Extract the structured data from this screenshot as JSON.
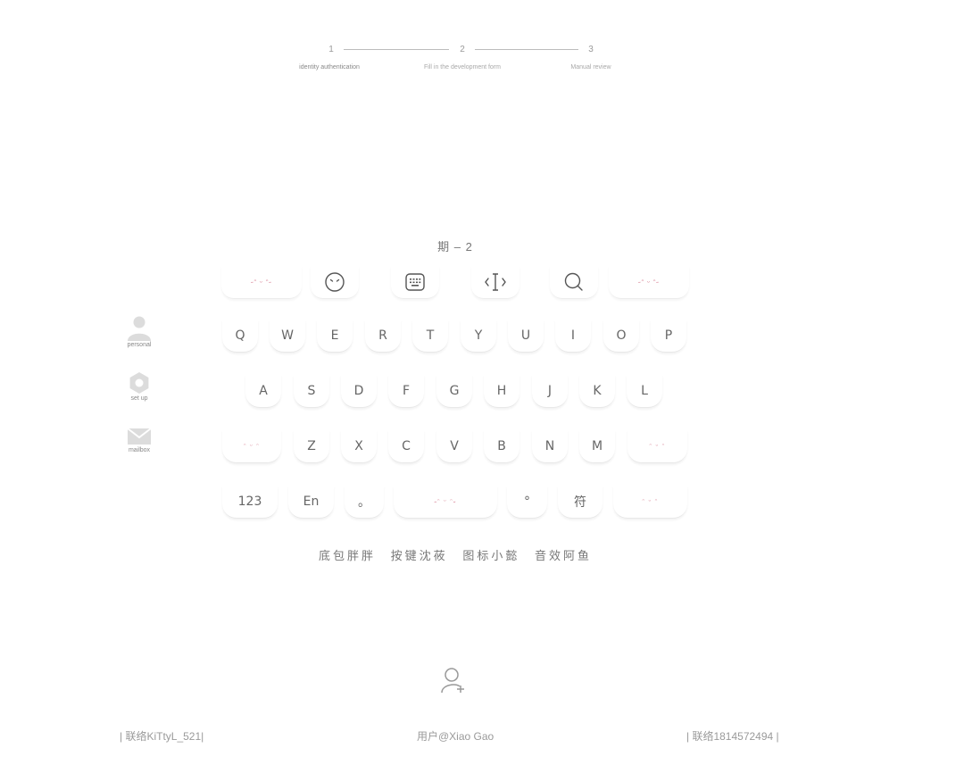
{
  "stepper": {
    "steps": [
      {
        "num": "1",
        "label": "identity authentication"
      },
      {
        "num": "2",
        "label": "Fill in the development form"
      },
      {
        "num": "3",
        "label": "Manual review"
      }
    ]
  },
  "sidenav": {
    "items": [
      {
        "label": "personal",
        "icon": "person-icon"
      },
      {
        "label": "set up",
        "icon": "gear-icon"
      },
      {
        "label": "mailbox",
        "icon": "mail-icon"
      }
    ]
  },
  "keyboard": {
    "title": "期 – 2",
    "toolbar_deco": [
      "˶ᵔ ᵕ ᵔ˶",
      "˶ᵔ ᵕ ᵔ˶"
    ],
    "row1": [
      "Q",
      "W",
      "E",
      "R",
      "T",
      "Y",
      "U",
      "I",
      "O",
      "P"
    ],
    "row2": [
      "A",
      "S",
      "D",
      "F",
      "G",
      "H",
      "J",
      "K",
      "L"
    ],
    "row3": [
      "Z",
      "X",
      "C",
      "V",
      "B",
      "N",
      "M"
    ],
    "row3_deco": [
      "ᵔ ᵕ ᵔ",
      "ᵔ ᵕ ᵔ"
    ],
    "row4": {
      "num": "123",
      "lang": "En",
      "dot1": "。",
      "space_deco": "˶ᵔ ᵕ ᵔ˶",
      "dot2": "°",
      "sym": "符",
      "enter_deco": "ᵔ ᵕ ᵔ"
    },
    "credits": [
      "底包胖胖",
      "按键沈莜",
      "图标小懿",
      "音效阿鱼"
    ]
  },
  "footer": {
    "left": "| 联络KiTtyL_521|",
    "center": "用户@Xiao Gao",
    "right": "|  联络1814572494  |"
  }
}
